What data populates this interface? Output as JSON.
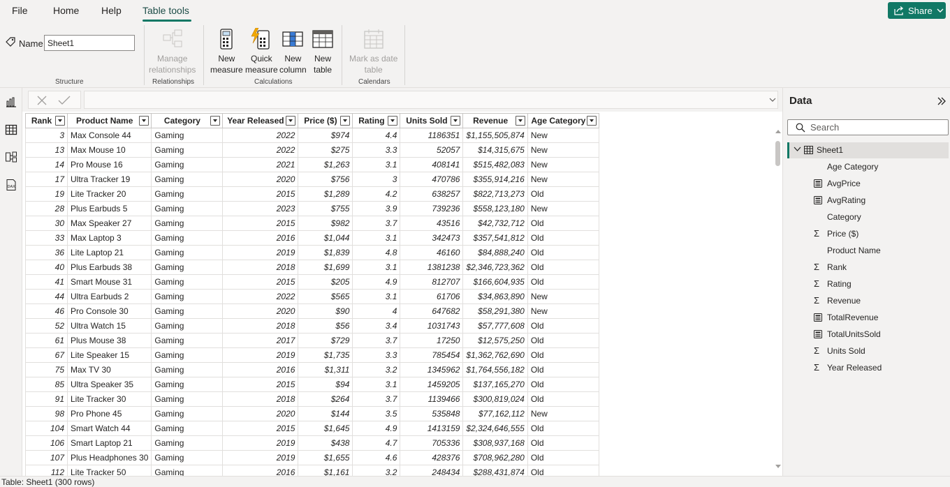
{
  "menu": {
    "tabs": [
      "File",
      "Home",
      "Help",
      "Table tools"
    ],
    "active": "Table tools",
    "share_label": "Share"
  },
  "ribbon": {
    "name_label": "Name",
    "name_value": "Sheet1",
    "structure_label": "Structure",
    "manage_relationships": [
      "Manage",
      "relationships"
    ],
    "relationships_label": "Relationships",
    "new_measure": [
      "New",
      "measure"
    ],
    "quick_measure": [
      "Quick",
      "measure"
    ],
    "new_column": [
      "New",
      "column"
    ],
    "new_table": [
      "New",
      "table"
    ],
    "calculations_label": "Calculations",
    "mark_as_date_table": [
      "Mark as date",
      "table"
    ],
    "calendars_label": "Calendars"
  },
  "grid": {
    "columns": [
      "Rank",
      "Product Name",
      "Category",
      "Year Released",
      "Price ($)",
      "Rating",
      "Units Sold",
      "Revenue",
      "Age Category"
    ],
    "rows": [
      [
        "3",
        "Max Console 44",
        "Gaming",
        "2022",
        "$974",
        "4.4",
        "1186351",
        "$1,155,505,874",
        "New"
      ],
      [
        "13",
        "Max Mouse 10",
        "Gaming",
        "2022",
        "$275",
        "3.3",
        "52057",
        "$14,315,675",
        "New"
      ],
      [
        "14",
        "Pro Mouse 16",
        "Gaming",
        "2021",
        "$1,263",
        "3.1",
        "408141",
        "$515,482,083",
        "New"
      ],
      [
        "17",
        "Ultra Tracker 19",
        "Gaming",
        "2020",
        "$756",
        "3",
        "470786",
        "$355,914,216",
        "New"
      ],
      [
        "19",
        "Lite Tracker 20",
        "Gaming",
        "2015",
        "$1,289",
        "4.2",
        "638257",
        "$822,713,273",
        "Old"
      ],
      [
        "28",
        "Plus Earbuds 5",
        "Gaming",
        "2023",
        "$755",
        "3.9",
        "739236",
        "$558,123,180",
        "New"
      ],
      [
        "30",
        "Max Speaker 27",
        "Gaming",
        "2015",
        "$982",
        "3.7",
        "43516",
        "$42,732,712",
        "Old"
      ],
      [
        "33",
        "Max Laptop 3",
        "Gaming",
        "2016",
        "$1,044",
        "3.1",
        "342473",
        "$357,541,812",
        "Old"
      ],
      [
        "36",
        "Lite Laptop 21",
        "Gaming",
        "2019",
        "$1,839",
        "4.8",
        "46160",
        "$84,888,240",
        "Old"
      ],
      [
        "40",
        "Plus Earbuds 38",
        "Gaming",
        "2018",
        "$1,699",
        "3.1",
        "1381238",
        "$2,346,723,362",
        "Old"
      ],
      [
        "41",
        "Smart Mouse 31",
        "Gaming",
        "2015",
        "$205",
        "4.9",
        "812707",
        "$166,604,935",
        "Old"
      ],
      [
        "44",
        "Ultra Earbuds 2",
        "Gaming",
        "2022",
        "$565",
        "3.1",
        "61706",
        "$34,863,890",
        "New"
      ],
      [
        "46",
        "Pro Console 30",
        "Gaming",
        "2020",
        "$90",
        "4",
        "647682",
        "$58,291,380",
        "New"
      ],
      [
        "52",
        "Ultra Watch 15",
        "Gaming",
        "2018",
        "$56",
        "3.4",
        "1031743",
        "$57,777,608",
        "Old"
      ],
      [
        "61",
        "Plus Mouse 38",
        "Gaming",
        "2017",
        "$729",
        "3.7",
        "17250",
        "$12,575,250",
        "Old"
      ],
      [
        "67",
        "Lite Speaker 15",
        "Gaming",
        "2019",
        "$1,735",
        "3.3",
        "785454",
        "$1,362,762,690",
        "Old"
      ],
      [
        "75",
        "Max TV 30",
        "Gaming",
        "2016",
        "$1,311",
        "3.2",
        "1345962",
        "$1,764,556,182",
        "Old"
      ],
      [
        "85",
        "Ultra Speaker 35",
        "Gaming",
        "2015",
        "$94",
        "3.1",
        "1459205",
        "$137,165,270",
        "Old"
      ],
      [
        "91",
        "Lite Tracker 30",
        "Gaming",
        "2018",
        "$264",
        "3.7",
        "1139466",
        "$300,819,024",
        "Old"
      ],
      [
        "98",
        "Pro Phone 45",
        "Gaming",
        "2020",
        "$144",
        "3.5",
        "535848",
        "$77,162,112",
        "New"
      ],
      [
        "104",
        "Smart Watch 44",
        "Gaming",
        "2015",
        "$1,645",
        "4.9",
        "1413159",
        "$2,324,646,555",
        "Old"
      ],
      [
        "106",
        "Smart Laptop 21",
        "Gaming",
        "2019",
        "$438",
        "4.7",
        "705336",
        "$308,937,168",
        "Old"
      ],
      [
        "107",
        "Plus Headphones 30",
        "Gaming",
        "2019",
        "$1,655",
        "4.6",
        "428376",
        "$708,962,280",
        "Old"
      ],
      [
        "112",
        "Lite Tracker 50",
        "Gaming",
        "2016",
        "$1,161",
        "3.2",
        "248434",
        "$288,431,874",
        "Old"
      ]
    ]
  },
  "data_pane": {
    "title": "Data",
    "search_placeholder": "Search",
    "table_name": "Sheet1",
    "fields": [
      {
        "label": "Age Category",
        "icon": "none"
      },
      {
        "label": "AvgPrice",
        "icon": "measure-icon"
      },
      {
        "label": "AvgRating",
        "icon": "measure-icon"
      },
      {
        "label": "Category",
        "icon": "none"
      },
      {
        "label": "Price ($)",
        "icon": "sigma-icon"
      },
      {
        "label": "Product Name",
        "icon": "none"
      },
      {
        "label": "Rank",
        "icon": "sigma-icon"
      },
      {
        "label": "Rating",
        "icon": "sigma-icon"
      },
      {
        "label": "Revenue",
        "icon": "sigma-icon"
      },
      {
        "label": "TotalRevenue",
        "icon": "measure-icon"
      },
      {
        "label": "TotalUnitsSold",
        "icon": "measure-icon"
      },
      {
        "label": "Units Sold",
        "icon": "sigma-icon"
      },
      {
        "label": "Year Released",
        "icon": "sigma-icon"
      }
    ]
  },
  "status": {
    "text": "Table: Sheet1 (300 rows)"
  },
  "colors": {
    "accent": "#117865",
    "ribbon_bg": "#f3f2f1"
  }
}
